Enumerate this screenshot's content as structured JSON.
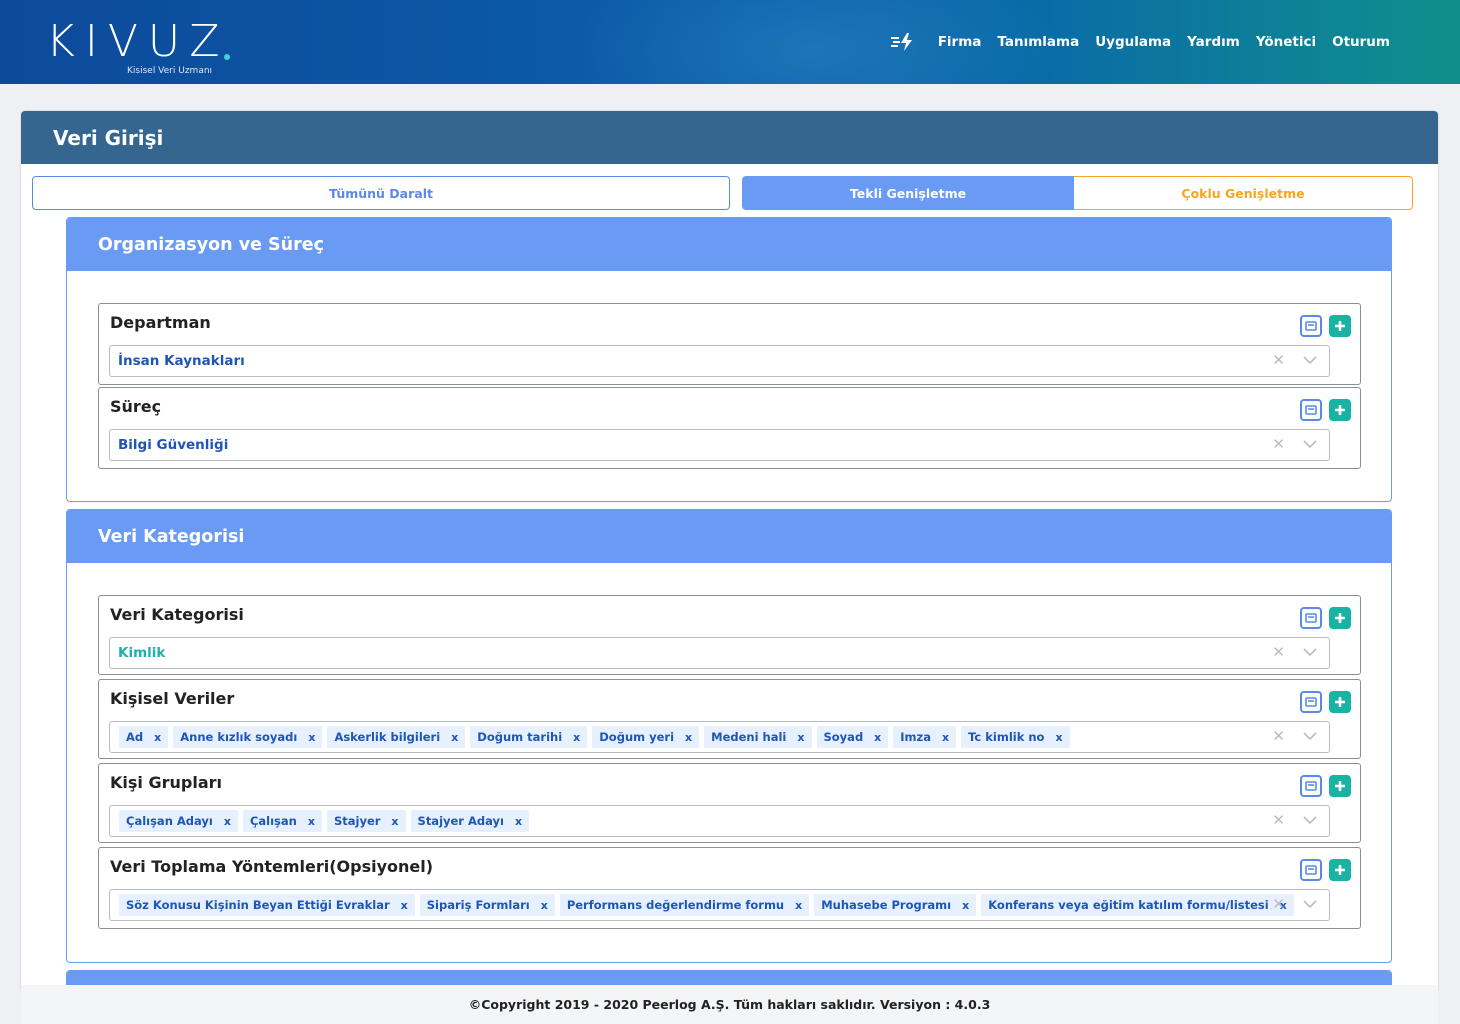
{
  "brand": {
    "name": "KIVUZ",
    "tagline": "Kisisel Veri Uzmanı"
  },
  "nav": [
    "Firma",
    "Tanımlama",
    "Uygulama",
    "Yardım",
    "Yönetici",
    "Oturum"
  ],
  "page": {
    "title": "Veri Girişi"
  },
  "toolbar": {
    "collapse_all": "Tümünü Daralt",
    "single_expand": "Tekli Genişletme",
    "multi_expand": "Çoklu Genişletme"
  },
  "sections": {
    "org": {
      "title": "Organizasyon ve Süreç",
      "department": {
        "label": "Departman",
        "value": "İnsan Kaynakları"
      },
      "process": {
        "label": "Süreç",
        "value": "Bilgi Güvenliği"
      }
    },
    "category": {
      "title": "Veri Kategorisi",
      "data_category": {
        "label": "Veri Kategorisi",
        "value": "Kimlik"
      },
      "personal_data": {
        "label": "Kişisel Veriler",
        "tags": [
          "Ad",
          "Anne kızlık soyadı",
          "Askerlik bilgileri",
          "Doğum tarihi",
          "Doğum yeri",
          "Medeni hali",
          "Soyad",
          "Imza",
          "Tc kimlik no"
        ]
      },
      "person_groups": {
        "label": "Kişi Grupları",
        "tags": [
          "Çalışan Adayı",
          "Çalışan",
          "Stajyer",
          "Stajyer Adayı"
        ]
      },
      "collection_methods": {
        "label": "Veri Toplama Yöntemleri(Opsiyonel)",
        "tags": [
          "Söz Konusu Kişinin Beyan Ettiği Evraklar",
          "Sipariş Formları",
          "Performans değerlendirme formu",
          "Muhasebe Programı",
          "Konferans veya eğitim katılım formu/listesi"
        ]
      }
    }
  },
  "footer": {
    "text": "©Copyright 2019 - 2020 Peerlog A.Ş. Tüm hakları saklıdır. Versiyon : 4.0.3"
  },
  "colors": {
    "header": "#34668f",
    "section": "#6a9bf4",
    "accent_orange": "#f5a623",
    "add_green": "#19b3a3"
  }
}
